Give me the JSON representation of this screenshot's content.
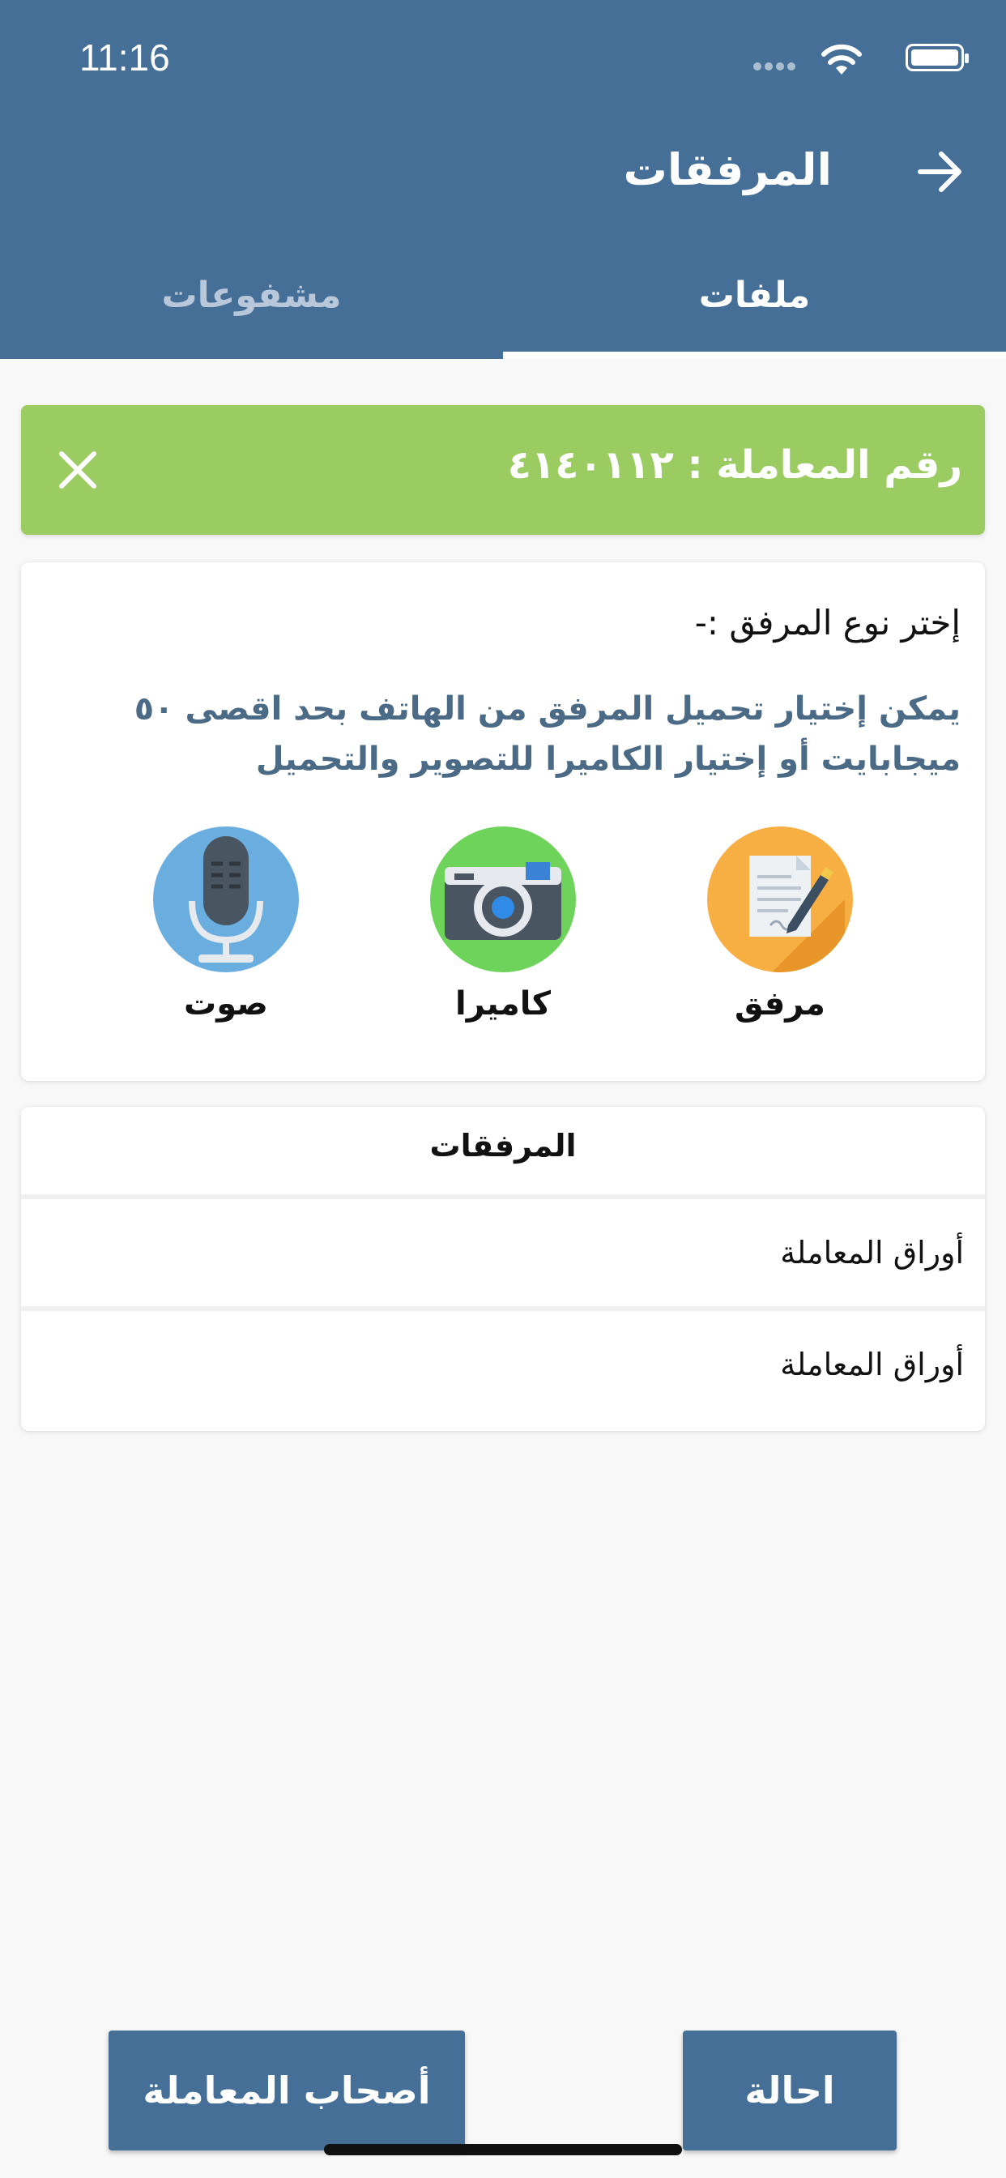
{
  "status_bar": {
    "time": "11:16"
  },
  "header": {
    "title": "المرفقات",
    "tabs": [
      {
        "label": "ملفات",
        "active": true
      },
      {
        "label": "مشفوعات",
        "active": false
      }
    ]
  },
  "banner": {
    "text": "رقم المعاملة : ٤١٤٠١١٢",
    "color": "#9bcc62"
  },
  "upload_card": {
    "prompt": "إختر نوع المرفق :-",
    "hint": "يمكن إختيار تحميل المرفق من الهاتف بحد اقصى ٥٠ ميجابايت أو إختيار الكاميرا للتصوير والتحميل",
    "options": [
      {
        "label": "مرفق",
        "icon": "document-pencil-icon",
        "color": "#f7ae42"
      },
      {
        "label": "كاميرا",
        "icon": "camera-icon",
        "color": "#6dd35a"
      },
      {
        "label": "صوت",
        "icon": "microphone-icon",
        "color": "#6aaee0"
      }
    ]
  },
  "attachments": {
    "header": "المرفقات",
    "rows": [
      "أوراق المعاملة",
      "أوراق المعاملة"
    ]
  },
  "buttons": {
    "owners": "أصحاب المعاملة",
    "refer": "احالة"
  },
  "colors": {
    "primary": "#456f96",
    "hint_text": "#4a6a86"
  }
}
